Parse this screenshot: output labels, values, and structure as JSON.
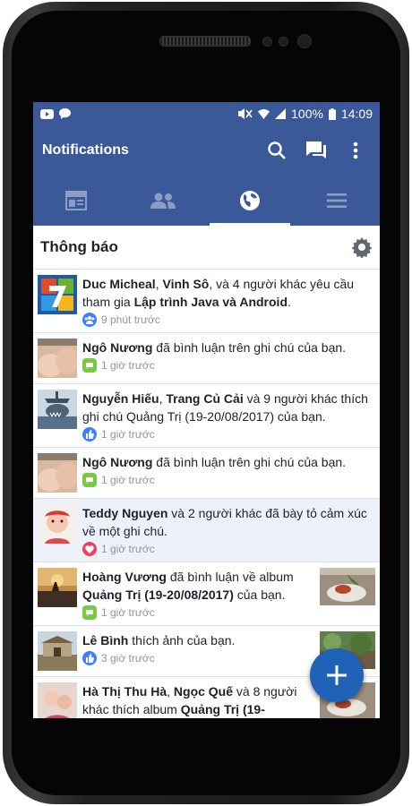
{
  "status": {
    "time": "14:09",
    "battery": "100%"
  },
  "toolbar": {
    "title": "Notifications"
  },
  "section": {
    "title": "Thông báo"
  },
  "notifications": [
    {
      "parts": [
        [
          "Duc Micheal",
          true
        ],
        [
          ", ",
          false
        ],
        [
          "Vinh Sô",
          true
        ],
        [
          ", và 4 người khác yêu cầu tham gia ",
          false
        ],
        [
          "Lập trình Java và Android",
          true
        ],
        [
          ".",
          false
        ]
      ],
      "time": "9 phút trước",
      "type": "group",
      "unread": false
    },
    {
      "parts": [
        [
          "Ngô Nương",
          true
        ],
        [
          " đã bình luận trên ghi chú của bạn.",
          false
        ]
      ],
      "time": "1 giờ trước",
      "type": "comment",
      "unread": false
    },
    {
      "parts": [
        [
          "Nguyễn Hiếu",
          true
        ],
        [
          ", ",
          false
        ],
        [
          "Trang Củ Cải",
          true
        ],
        [
          " và 9 người khác thích ghi chú Quảng Trị (19-20/08/2017) của bạn.",
          false
        ]
      ],
      "time": "1 giờ trước",
      "type": "like",
      "unread": false
    },
    {
      "parts": [
        [
          "Ngô Nương",
          true
        ],
        [
          " đã bình luận trên ghi chú của bạn.",
          false
        ]
      ],
      "time": "1 giờ trước",
      "type": "comment",
      "unread": false
    },
    {
      "parts": [
        [
          "Teddy Nguyen",
          true
        ],
        [
          " và 2 người khác đã bày tỏ cảm xúc về một ghi chú.",
          false
        ]
      ],
      "time": "1 giờ trước",
      "type": "love",
      "unread": true
    },
    {
      "parts": [
        [
          "Hoàng Vương",
          true
        ],
        [
          " đã bình luận về album ",
          false
        ],
        [
          "Quảng Trị (19-20/08/2017)",
          true
        ],
        [
          " của bạn.",
          false
        ]
      ],
      "time": "1 giờ trước",
      "type": "comment",
      "unread": false
    },
    {
      "parts": [
        [
          "Lê Bình",
          true
        ],
        [
          " thích ảnh của bạn.",
          false
        ]
      ],
      "time": "3 giờ trước",
      "type": "like",
      "unread": false
    },
    {
      "parts": [
        [
          "Hà Thị Thu Hà",
          true
        ],
        [
          ", ",
          false
        ],
        [
          "Ngọc Quế",
          true
        ],
        [
          " và 8 người khác thích album ",
          false
        ],
        [
          "Quảng Trị (19-",
          true
        ]
      ],
      "time": "",
      "type": "like",
      "unread": false
    }
  ],
  "colors": {
    "brand": "#3b5998",
    "fab": "#2062b8"
  },
  "icons": {
    "fab": "plus-icon",
    "search": "search-icon",
    "messages": "messages-icon",
    "menu": "overflow-menu-icon"
  }
}
